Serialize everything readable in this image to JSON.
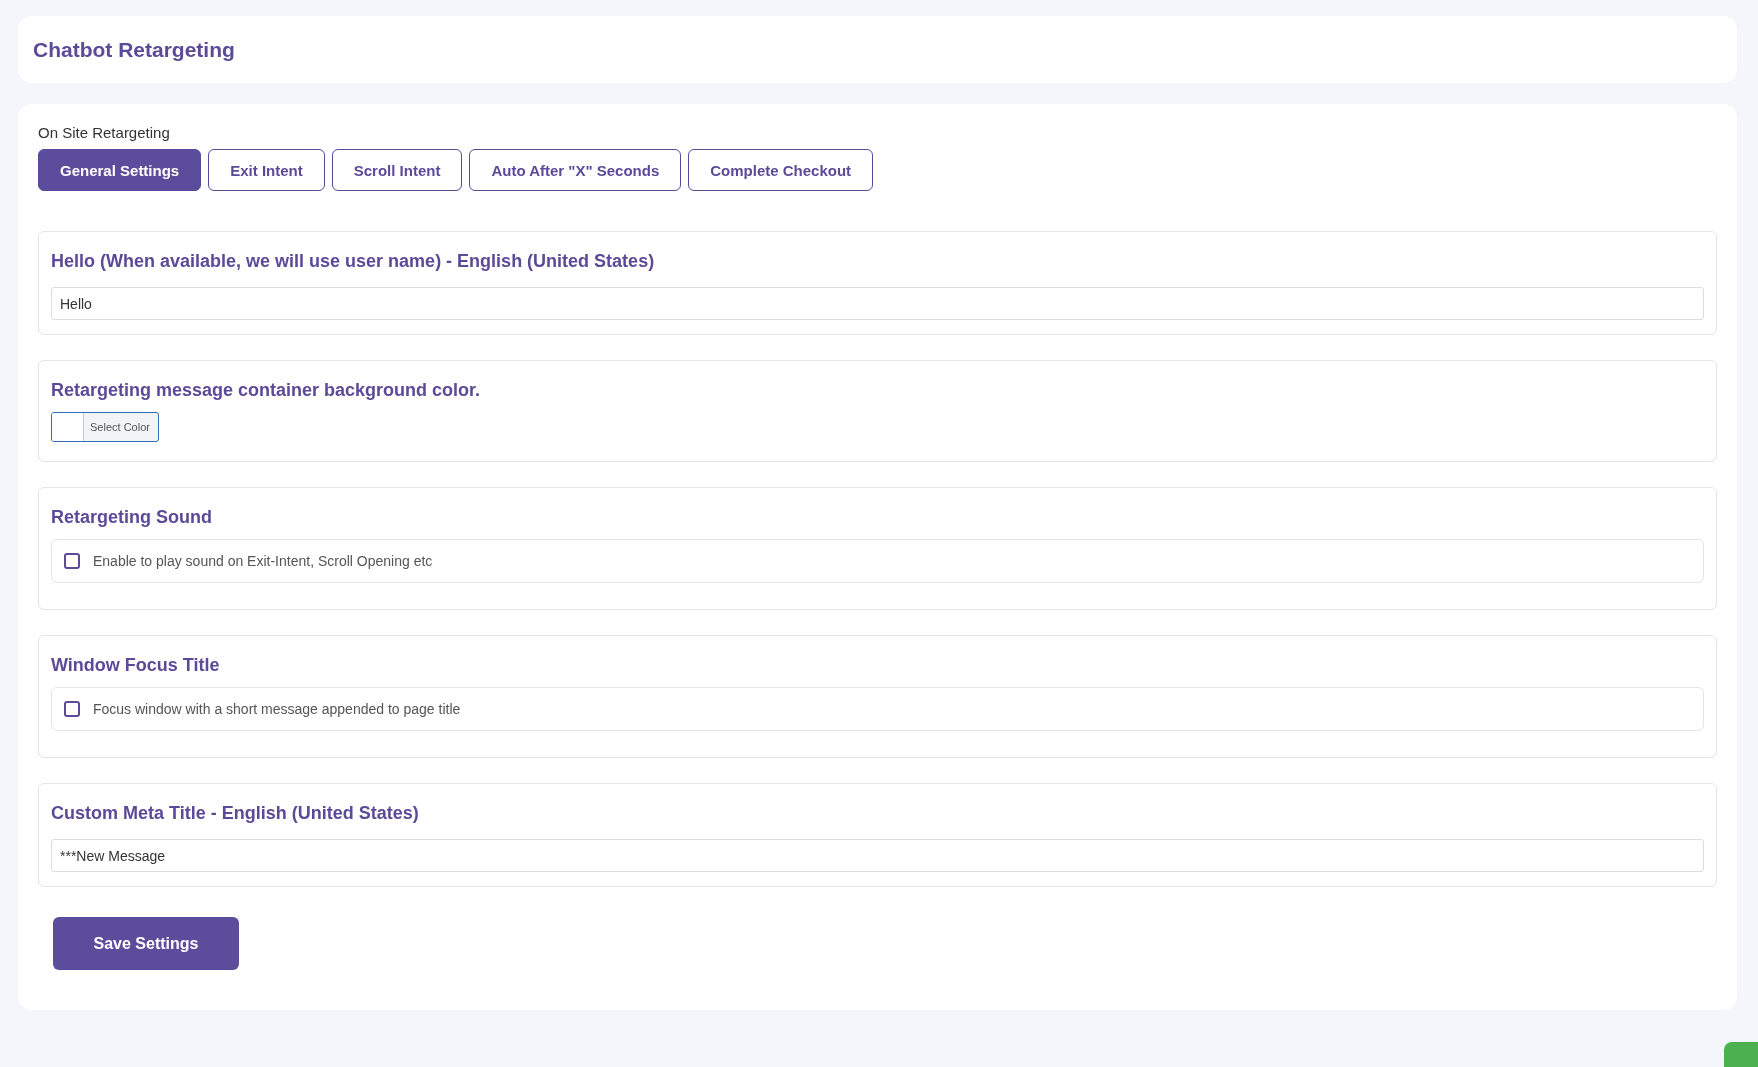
{
  "header": {
    "title": "Chatbot Retargeting"
  },
  "panel": {
    "label": "On Site Retargeting",
    "tabs": [
      {
        "label": "General Settings",
        "selected": true
      },
      {
        "label": "Exit Intent",
        "selected": false
      },
      {
        "label": "Scroll Intent",
        "selected": false
      },
      {
        "label": "Auto After \"X\" Seconds",
        "selected": false
      },
      {
        "label": "Complete Checkout",
        "selected": false
      }
    ],
    "sections": [
      {
        "kind": "text",
        "title": "Hello (When available, we will use user name) - English (United States)",
        "value": "Hello"
      },
      {
        "kind": "color",
        "title": "Retargeting message container background color.",
        "button": "Select Color",
        "color": "#ffffff"
      },
      {
        "kind": "checkbox",
        "title": "Retargeting Sound",
        "label": "Enable to play sound on Exit-Intent, Scroll Opening etc",
        "checked": false
      },
      {
        "kind": "checkbox",
        "title": "Window Focus Title",
        "label": "Focus window with a short message appended to page title",
        "checked": false
      },
      {
        "kind": "text",
        "title": "Custom Meta Title - English (United States)",
        "value": "***New Message"
      }
    ],
    "save_button": "Save Settings"
  }
}
